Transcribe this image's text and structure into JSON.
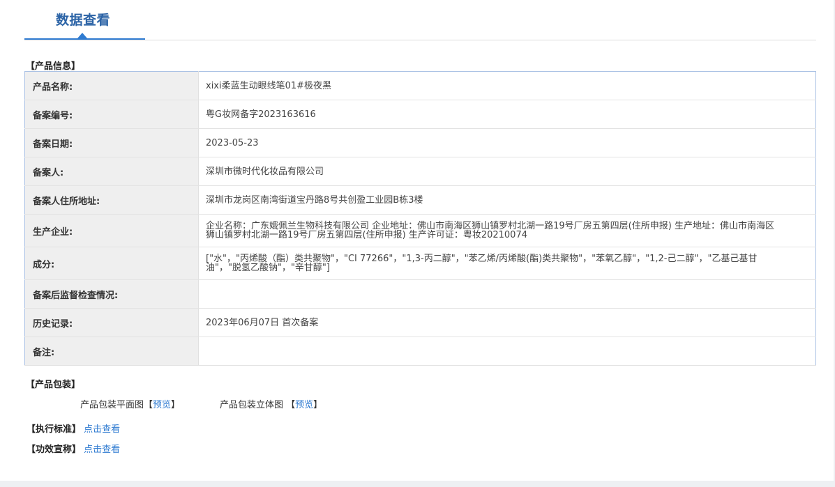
{
  "tab": {
    "title": "数据查看"
  },
  "product_info": {
    "section_title": "【产品信息】",
    "rows": [
      {
        "label": "产品名称:",
        "value": "xixi柔蓝生动眼线笔01#极夜黑"
      },
      {
        "label": "备案编号:",
        "value": "粤G妆网备字2023163616"
      },
      {
        "label": "备案日期:",
        "value": "2023-05-23"
      },
      {
        "label": "备案人:",
        "value": "深圳市微时代化妆品有限公司"
      },
      {
        "label": "备案人住所地址:",
        "value": "深圳市龙岗区南湾街道宝丹路8号共创盈工业园B栋3楼"
      },
      {
        "label": "生产企业:",
        "value": "企业名称：广东娥佩兰生物科技有限公司 企业地址：佛山市南海区狮山镇罗村北湖一路19号厂房五第四层(住所申报) 生产地址：佛山市南海区狮山镇罗村北湖一路19号厂房五第四层(住所申报) 生产许可证：粤妆20210074"
      },
      {
        "label": "成分:",
        "value": "[\"水\"，\"丙烯酸（酯）类共聚物\"，\"CI 77266\"，\"1,3-丙二醇\"，\"苯乙烯/丙烯酸(酯)类共聚物\"，\"苯氧乙醇\"，\"1,2-己二醇\"，\"乙基己基甘油\"，\"脱氢乙酸钠\"，\"辛甘醇\"]"
      },
      {
        "label": "备案后监督检查情况:",
        "value": ""
      },
      {
        "label": "历史记录:",
        "value": "2023年06月07日 首次备案"
      },
      {
        "label": "备注:",
        "value": ""
      }
    ]
  },
  "packaging": {
    "section_title": "【产品包装】",
    "flat_label": "产品包装平面图【",
    "flat_link": "预览",
    "flat_close": "】",
    "solid_label": "产品包装立体图 【",
    "solid_link": "预览",
    "solid_close": "】"
  },
  "standard": {
    "label": "【执行标准】",
    "link": "点击查看"
  },
  "efficacy": {
    "label": "【功效宣称】",
    "link": "点击查看"
  },
  "colors": {
    "accent": "#2f7bd1",
    "title": "#2b63a6",
    "label_bg": "#efefef",
    "table_border": "#a9c1e4"
  }
}
